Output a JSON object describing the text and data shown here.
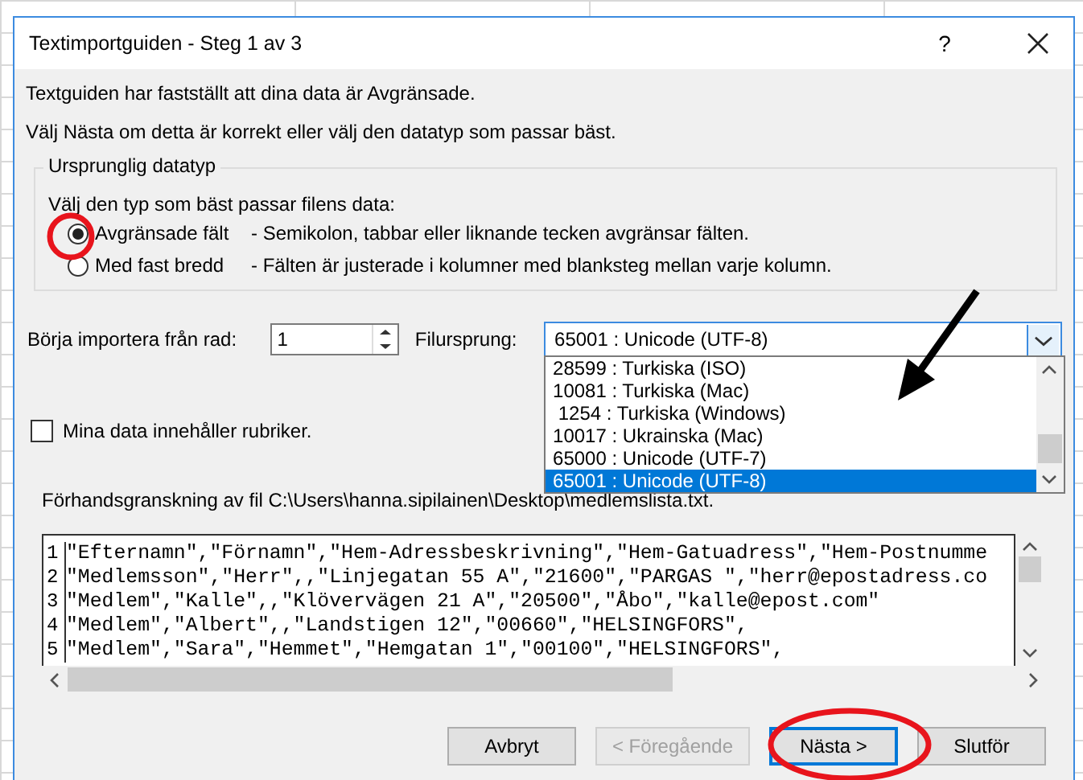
{
  "window": {
    "title": "Textimportguiden - Steg 1 av 3",
    "help": "?"
  },
  "intro": [
    "Textguiden har fastställt att dina data är Avgränsade.",
    "Välj Nästa om detta är korrekt eller välj den datatyp som passar bäst."
  ],
  "group": {
    "title": "Ursprunglig datatyp",
    "prompt": "Välj den typ som bäst passar filens data:",
    "options": [
      {
        "label": "Avgränsade fält",
        "description": "- Semikolon, tabbar eller liknande tecken avgränsar fälten.",
        "selected": true
      },
      {
        "label": "Med fast bredd",
        "description": "- Fälten är justerade i kolumner med blanksteg mellan varje kolumn.",
        "selected": false
      }
    ]
  },
  "start_row": {
    "label": "Börja importera från rad:",
    "value": "1"
  },
  "file_origin": {
    "label": "Filursprung:",
    "value": "65001 : Unicode (UTF-8)",
    "expanded": true,
    "options": [
      {
        "label": "28599 : Turkiska (ISO)",
        "selected": false
      },
      {
        "label": "10081 : Turkiska (Mac)",
        "selected": false
      },
      {
        "label": " 1254 : Turkiska (Windows)",
        "selected": false
      },
      {
        "label": "10017 : Ukrainska (Mac)",
        "selected": false
      },
      {
        "label": "65000 : Unicode (UTF-7)",
        "selected": false
      },
      {
        "label": "65001 : Unicode (UTF-8)",
        "selected": true
      }
    ]
  },
  "headers_checkbox": {
    "label": "Mina data innehåller rubriker.",
    "checked": false
  },
  "preview": {
    "title": "Förhandsgranskning av fil C:\\Users\\hanna.sipilainen\\Desktop\\medlemslista.txt.",
    "rows": [
      {
        "number": "1",
        "text": "\"Efternamn\",\"Förnamn\",\"Hem-Adressbeskrivning\",\"Hem-Gatuadress\",\"Hem-Postnumme"
      },
      {
        "number": "2",
        "text": "\"Medlemsson\",\"Herr\",,\"Linjegatan 55 A\",\"21600\",\"PARGAS \",\"herr@epostadress.co"
      },
      {
        "number": "3",
        "text": "\"Medlem\",\"Kalle\",,\"Klövervägen 21 A\",\"20500\",\"Åbo\",\"kalle@epost.com\""
      },
      {
        "number": "4",
        "text": "\"Medlem\",\"Albert\",,\"Landstigen 12\",\"00660\",\"HELSINGFORS\","
      },
      {
        "number": "5",
        "text": "\"Medlem\",\"Sara\",\"Hemmet\",\"Hemgatan 1\",\"00100\",\"HELSINGFORS\","
      }
    ]
  },
  "buttons": [
    {
      "label": "Avbryt",
      "disabled": false,
      "default": false
    },
    {
      "label": "< Föregående",
      "disabled": true,
      "default": false
    },
    {
      "label": "Nästa >",
      "disabled": false,
      "default": true
    },
    {
      "label": "Slutför",
      "disabled": false,
      "default": false
    }
  ]
}
